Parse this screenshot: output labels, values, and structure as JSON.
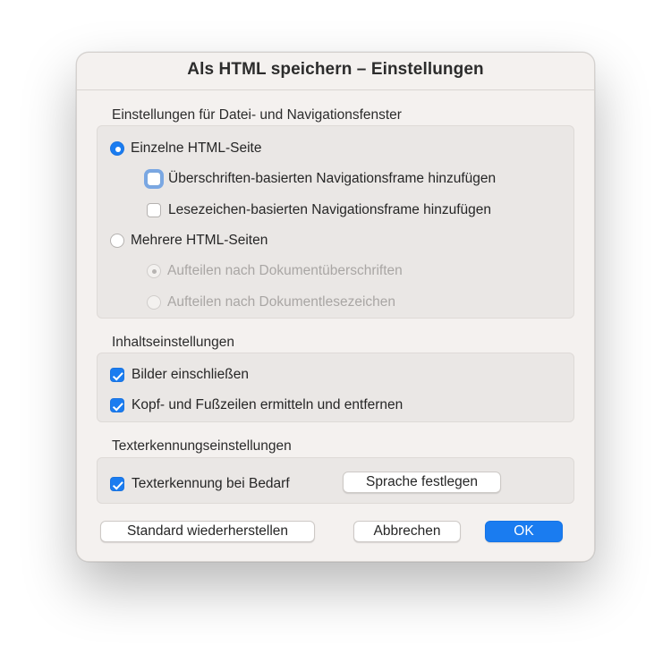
{
  "dialog": {
    "title": "Als HTML speichern – Einstellungen"
  },
  "file_nav_section": {
    "heading": "Einstellungen für Datei- und Navigationsfenster",
    "single_page_label": "Einzelne HTML-Seite",
    "single_page_selected": true,
    "heading_nav_label": "Überschriften-basierten Navigationsframe hinzufügen",
    "heading_nav_checked": false,
    "bookmark_nav_label": "Lesezeichen-basierten Navigationsframe hinzufügen",
    "bookmark_nav_checked": false,
    "multi_page_label": "Mehrere HTML-Seiten",
    "multi_page_selected": false,
    "split_headings_label": "Aufteilen nach Dokumentüberschriften",
    "split_bookmarks_label": "Aufteilen nach Dokumentlesezeichen"
  },
  "content_section": {
    "heading": "Inhaltseinstellungen",
    "include_images_label": "Bilder einschließen",
    "include_images_checked": true,
    "header_footer_label": "Kopf- und Fußzeilen ermitteln und entfernen",
    "header_footer_checked": true
  },
  "ocr_section": {
    "heading": "Texterkennungseinstellungen",
    "ocr_label": "Texterkennung bei Bedarf",
    "ocr_checked": true,
    "language_button": "Sprache festlegen"
  },
  "footer": {
    "restore_defaults": "Standard wiederherstellen",
    "cancel": "Abbrechen",
    "ok": "OK"
  },
  "colors": {
    "accent": "#1a7cf0",
    "dialog_bg": "#f4f1ef",
    "group_bg": "#eae7e5"
  }
}
